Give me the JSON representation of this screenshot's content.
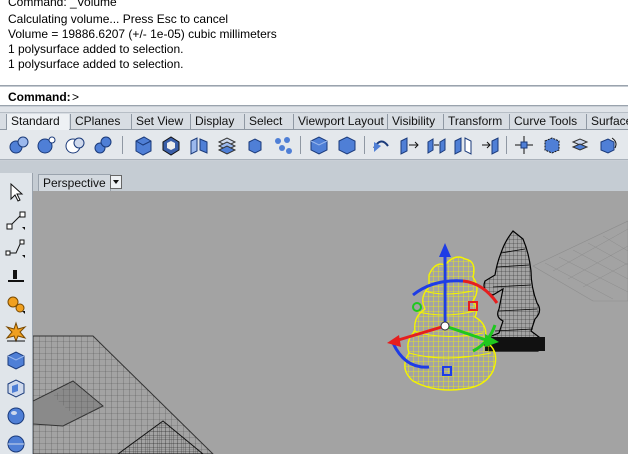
{
  "command_history": [
    "Command: _Volume",
    "Calculating volume... Press Esc to cancel",
    "Volume = 19886.6207 (+/- 1e-05) cubic millimeters",
    "1 polysurface added to selection.",
    "1 polysurface added to selection."
  ],
  "command_prompt": {
    "label": "Command:",
    "value": ">"
  },
  "tabs": [
    {
      "label": "Standard",
      "active": true
    },
    {
      "label": "CPlanes"
    },
    {
      "label": "Set View"
    },
    {
      "label": "Display"
    },
    {
      "label": "Select"
    },
    {
      "label": "Viewport Layout"
    },
    {
      "label": "Visibility"
    },
    {
      "label": "Transform"
    },
    {
      "label": "Curve Tools"
    },
    {
      "label": "Surface"
    }
  ],
  "toolbar_icons": [
    "spheres-icon",
    "spheres-alt-icon",
    "spheres-wire-icon",
    "spheres-join-icon",
    "box-icon",
    "box-shaded-icon",
    "explode-icon",
    "layers-icon",
    "box-small-icon",
    "points-icon",
    "cube-icon",
    "cube-alt-icon",
    "rotate-view-icon",
    "move-icon",
    "copy-icon",
    "mirror-icon",
    "scale-icon",
    "gumball-icon",
    "box-edit-icon",
    "boolean-icon",
    "transform-icon"
  ],
  "left_tools": [
    "select-arrow-icon",
    "point-icon",
    "polyline-icon",
    "curve-icon",
    "transform-gears-icon",
    "explosion-icon",
    "solid-box-icon",
    "wire-box-icon",
    "sphere-icon",
    "sphere-alt-icon"
  ],
  "viewport": {
    "title": "Perspective"
  },
  "colors": {
    "selection": "#f4f400",
    "gumball_x": "#e61e1e",
    "gumball_y": "#1ec81e",
    "gumball_z": "#1e3ce6",
    "viewport_bg": "#a3a3a3"
  }
}
